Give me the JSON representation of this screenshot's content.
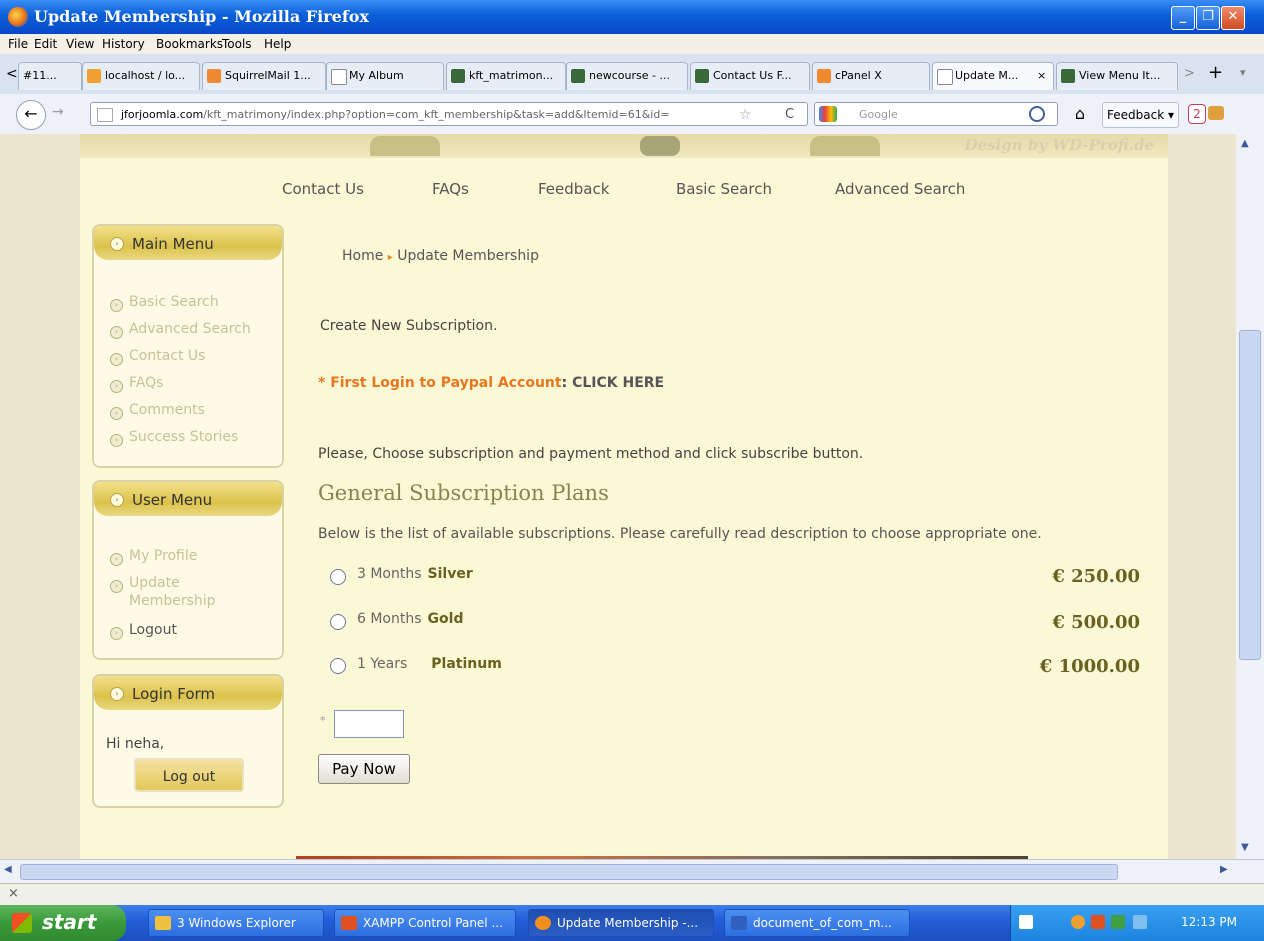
{
  "window": {
    "title": "Update Membership - Mozilla Firefox",
    "min_glyph": "_",
    "max_glyph": "❐",
    "close_glyph": "✕"
  },
  "menubar": [
    "File",
    "Edit",
    "View",
    "History",
    "Bookmarks",
    "Tools",
    "Help"
  ],
  "tabs": [
    {
      "label": "#11...",
      "icon_color": ""
    },
    {
      "label": "localhost / lo...",
      "icon_color": "#f0a030"
    },
    {
      "label": "SquirrelMail 1...",
      "icon_color": "#f08a30"
    },
    {
      "label": "My Album",
      "icon_color": "#ffffff"
    },
    {
      "label": "kft_matrimon...",
      "icon_color": "#3a6a3a"
    },
    {
      "label": "newcourse - ...",
      "icon_color": "#3a6a3a"
    },
    {
      "label": "Contact Us F...",
      "icon_color": "#3a6a3a"
    },
    {
      "label": "cPanel X",
      "icon_color": "#f08a30"
    },
    {
      "label": "Update M...",
      "icon_color": "#ffffff"
    },
    {
      "label": "View Menu It...",
      "icon_color": "#3a6a3a"
    }
  ],
  "tabbar": {
    "close_glyph": "×",
    "newtab_glyph": "+",
    "scroll_left": "<",
    "scroll_right": ">",
    "list_glyph": "▾"
  },
  "nav": {
    "url_domain": "jforjoomla.com",
    "url_path": "/kft_matrimony/index.php?option=com_kft_membership&task=add&Itemid=61&id=",
    "search_placeholder": "Google",
    "feedback": "Feedback",
    "badge": "2",
    "back": "←",
    "forward": "→",
    "star": "☆",
    "reload": "C",
    "home": "⌂"
  },
  "banner_text": "Design by WD-Profi.de",
  "top_nav": [
    "Contact Us",
    "FAQs",
    "Feedback",
    "Basic Search",
    "Advanced Search"
  ],
  "main_menu": {
    "title": "Main Menu",
    "items": [
      "Basic Search",
      "Advanced Search",
      "Contact Us",
      "FAQs",
      "Comments",
      "Success Stories"
    ]
  },
  "user_menu": {
    "title": "User Menu",
    "items": [
      "My Profile",
      "Update",
      "Membership",
      "Logout"
    ]
  },
  "login_form": {
    "title": "Login Form",
    "greeting": "Hi neha,",
    "logout_button": "Log out"
  },
  "breadcrumb": {
    "home": "Home",
    "separator": "▸",
    "current": "Update Membership"
  },
  "content": {
    "create_text": "Create New Subscription.",
    "paypal_prefix": "* First Login to Paypal Account",
    "paypal_colon": ":",
    "paypal_link": "CLICK HERE",
    "choose_text": "Please, Choose subscription and payment method and click subscribe button.",
    "plans_heading": "General Subscription Plans",
    "plans_desc": "Below is the list of available subscriptions. Please carefully read description to choose appropriate one.",
    "plans": [
      {
        "duration": "3 Months",
        "name": "Silver",
        "price": "€ 250.00"
      },
      {
        "duration": "6 Months",
        "name": "Gold",
        "price": "€ 500.00"
      },
      {
        "duration": "1 Years",
        "name": "Platinum",
        "price": "€ 1000.00"
      }
    ],
    "required_mark": "*",
    "pay_button": "Pay Now"
  },
  "status": {
    "close_glyph": "×"
  },
  "taskbar": {
    "start": "start",
    "tasks": [
      {
        "label": "3 Windows Explorer",
        "icon_color": "#f0c040"
      },
      {
        "label": "XAMPP Control Panel ...",
        "icon_color": "#e05020"
      },
      {
        "label": "Update Membership -...",
        "icon_color": "#f09020"
      },
      {
        "label": "document_of_com_m...",
        "icon_color": "#3060c0"
      }
    ],
    "clock": "12:13 PM"
  }
}
